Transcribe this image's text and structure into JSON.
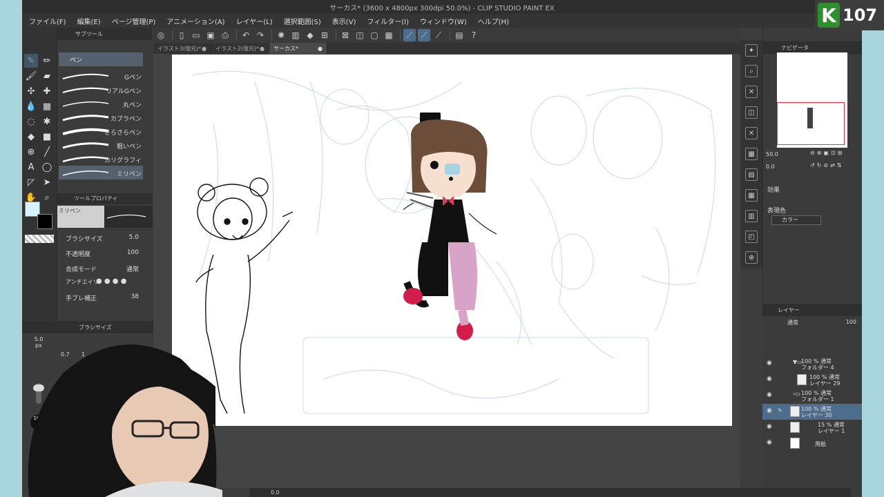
{
  "window": {
    "title": "サーカス* (3600 x 4800px 300dpi 50.0%) - CLIP STUDIO PAINT EX"
  },
  "menu": [
    "ファイル(F)",
    "編集(E)",
    "ページ管理(P)",
    "アニメーション(A)",
    "レイヤー(L)",
    "選択範囲(S)",
    "表示(V)",
    "フィルター(I)",
    "ウィンドウ(W)",
    "ヘルプ(H)"
  ],
  "tabs": [
    {
      "label": "イラスト3(復元)*"
    },
    {
      "label": "イラスト2(復元)*"
    },
    {
      "label": "サーカス*"
    }
  ],
  "subtool": {
    "header": "サブツール",
    "group": "ペン",
    "brushes": [
      "Gペン",
      "リアルGペン",
      "丸ペン",
      "カブラペン",
      "さらさらペン",
      "粗いペン",
      "カリグラフィ",
      "ミリペン"
    ]
  },
  "tool_property": {
    "header": "ツールプロパティ",
    "name": "ミリペン",
    "brush_size_label": "ブラシサイズ",
    "brush_size": "5.0",
    "opacity_label": "不透明度",
    "opacity": "100",
    "blend_label": "合成モード",
    "blend_value": "通常",
    "antialias_label": "アンチエイリ",
    "stabilize_label": "手ブレ補正",
    "stabilize_value": "38"
  },
  "brush_size_panel": {
    "header": "ブラシサイズ",
    "size_value": "5.0",
    "size_unit": "px",
    "preset_a": "0.7",
    "preset_b": "1",
    "opacity_value": "100",
    "opacity_unit": "%"
  },
  "navigator": {
    "header": "ナビゲータ",
    "zoom": "50.0",
    "rotation": "0.0"
  },
  "effects": {
    "label": "効果",
    "color_label": "表現色",
    "color_value": "カラー"
  },
  "layers": {
    "header": "レイヤー",
    "blend": "通常",
    "opacity": "100",
    "items": [
      {
        "line1": "100 % 通常",
        "line2": "フォルダー 4"
      },
      {
        "line1": "100 % 通常",
        "line2": "レイヤー 29"
      },
      {
        "line1": "100 % 通常",
        "line2": "フォルダー 1"
      },
      {
        "line1": "100 % 通常",
        "line2": "レイヤー 30"
      },
      {
        "line1": "15 % 通常",
        "line2": "レイヤー 1"
      },
      {
        "line1": "",
        "line2": "用紙"
      }
    ]
  },
  "status": {
    "zoom": "0.0"
  },
  "badge": {
    "letter": "K",
    "number": "107"
  },
  "colors": {
    "accent": "#4e6c8c",
    "main_color": "#d6f4fb",
    "sub_color": "#000000"
  }
}
